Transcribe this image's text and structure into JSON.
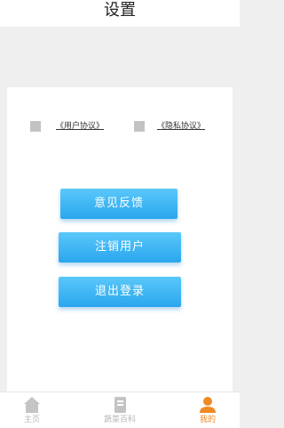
{
  "header": {
    "title": "设置"
  },
  "agreements": {
    "user_agreement": "《用户协议》",
    "privacy_agreement": "《隐私协议》"
  },
  "buttons": {
    "feedback": "意见反馈",
    "cancel_account": "注销用户",
    "logout": "退出登录"
  },
  "tabbar": {
    "items": [
      {
        "label": "主页",
        "icon": "home-icon",
        "active": false
      },
      {
        "label": "蔬菜百科",
        "icon": "book-icon",
        "active": false
      },
      {
        "label": "我的",
        "icon": "user-icon",
        "active": true
      }
    ]
  },
  "colors": {
    "accent": "#f08a24",
    "button": "#2aa6ee",
    "inactive": "#b7b7b7",
    "background": "#efefef"
  }
}
